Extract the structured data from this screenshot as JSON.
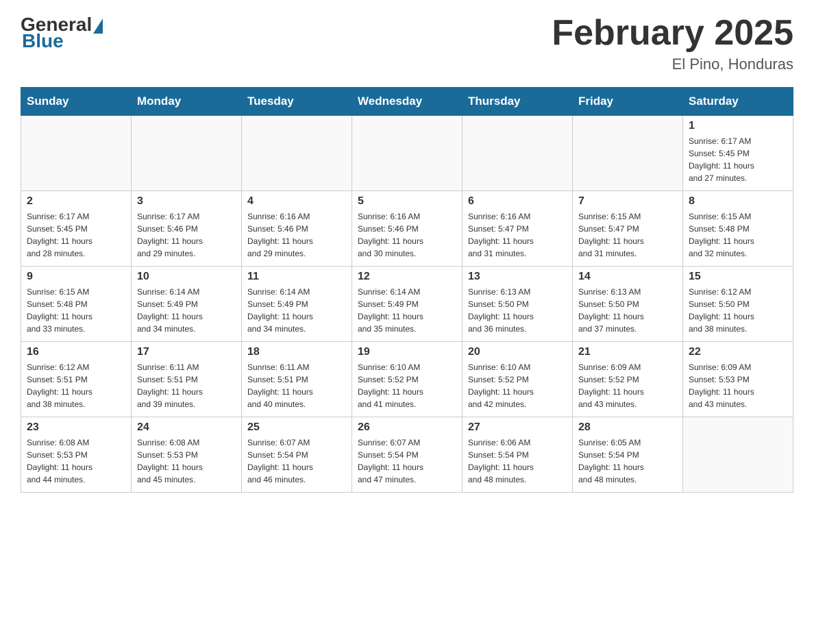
{
  "logo": {
    "general": "General",
    "blue": "Blue"
  },
  "header": {
    "title": "February 2025",
    "subtitle": "El Pino, Honduras"
  },
  "weekdays": [
    "Sunday",
    "Monday",
    "Tuesday",
    "Wednesday",
    "Thursday",
    "Friday",
    "Saturday"
  ],
  "weeks": [
    [
      {
        "day": "",
        "info": ""
      },
      {
        "day": "",
        "info": ""
      },
      {
        "day": "",
        "info": ""
      },
      {
        "day": "",
        "info": ""
      },
      {
        "day": "",
        "info": ""
      },
      {
        "day": "",
        "info": ""
      },
      {
        "day": "1",
        "info": "Sunrise: 6:17 AM\nSunset: 5:45 PM\nDaylight: 11 hours\nand 27 minutes."
      }
    ],
    [
      {
        "day": "2",
        "info": "Sunrise: 6:17 AM\nSunset: 5:45 PM\nDaylight: 11 hours\nand 28 minutes."
      },
      {
        "day": "3",
        "info": "Sunrise: 6:17 AM\nSunset: 5:46 PM\nDaylight: 11 hours\nand 29 minutes."
      },
      {
        "day": "4",
        "info": "Sunrise: 6:16 AM\nSunset: 5:46 PM\nDaylight: 11 hours\nand 29 minutes."
      },
      {
        "day": "5",
        "info": "Sunrise: 6:16 AM\nSunset: 5:46 PM\nDaylight: 11 hours\nand 30 minutes."
      },
      {
        "day": "6",
        "info": "Sunrise: 6:16 AM\nSunset: 5:47 PM\nDaylight: 11 hours\nand 31 minutes."
      },
      {
        "day": "7",
        "info": "Sunrise: 6:15 AM\nSunset: 5:47 PM\nDaylight: 11 hours\nand 31 minutes."
      },
      {
        "day": "8",
        "info": "Sunrise: 6:15 AM\nSunset: 5:48 PM\nDaylight: 11 hours\nand 32 minutes."
      }
    ],
    [
      {
        "day": "9",
        "info": "Sunrise: 6:15 AM\nSunset: 5:48 PM\nDaylight: 11 hours\nand 33 minutes."
      },
      {
        "day": "10",
        "info": "Sunrise: 6:14 AM\nSunset: 5:49 PM\nDaylight: 11 hours\nand 34 minutes."
      },
      {
        "day": "11",
        "info": "Sunrise: 6:14 AM\nSunset: 5:49 PM\nDaylight: 11 hours\nand 34 minutes."
      },
      {
        "day": "12",
        "info": "Sunrise: 6:14 AM\nSunset: 5:49 PM\nDaylight: 11 hours\nand 35 minutes."
      },
      {
        "day": "13",
        "info": "Sunrise: 6:13 AM\nSunset: 5:50 PM\nDaylight: 11 hours\nand 36 minutes."
      },
      {
        "day": "14",
        "info": "Sunrise: 6:13 AM\nSunset: 5:50 PM\nDaylight: 11 hours\nand 37 minutes."
      },
      {
        "day": "15",
        "info": "Sunrise: 6:12 AM\nSunset: 5:50 PM\nDaylight: 11 hours\nand 38 minutes."
      }
    ],
    [
      {
        "day": "16",
        "info": "Sunrise: 6:12 AM\nSunset: 5:51 PM\nDaylight: 11 hours\nand 38 minutes."
      },
      {
        "day": "17",
        "info": "Sunrise: 6:11 AM\nSunset: 5:51 PM\nDaylight: 11 hours\nand 39 minutes."
      },
      {
        "day": "18",
        "info": "Sunrise: 6:11 AM\nSunset: 5:51 PM\nDaylight: 11 hours\nand 40 minutes."
      },
      {
        "day": "19",
        "info": "Sunrise: 6:10 AM\nSunset: 5:52 PM\nDaylight: 11 hours\nand 41 minutes."
      },
      {
        "day": "20",
        "info": "Sunrise: 6:10 AM\nSunset: 5:52 PM\nDaylight: 11 hours\nand 42 minutes."
      },
      {
        "day": "21",
        "info": "Sunrise: 6:09 AM\nSunset: 5:52 PM\nDaylight: 11 hours\nand 43 minutes."
      },
      {
        "day": "22",
        "info": "Sunrise: 6:09 AM\nSunset: 5:53 PM\nDaylight: 11 hours\nand 43 minutes."
      }
    ],
    [
      {
        "day": "23",
        "info": "Sunrise: 6:08 AM\nSunset: 5:53 PM\nDaylight: 11 hours\nand 44 minutes."
      },
      {
        "day": "24",
        "info": "Sunrise: 6:08 AM\nSunset: 5:53 PM\nDaylight: 11 hours\nand 45 minutes."
      },
      {
        "day": "25",
        "info": "Sunrise: 6:07 AM\nSunset: 5:54 PM\nDaylight: 11 hours\nand 46 minutes."
      },
      {
        "day": "26",
        "info": "Sunrise: 6:07 AM\nSunset: 5:54 PM\nDaylight: 11 hours\nand 47 minutes."
      },
      {
        "day": "27",
        "info": "Sunrise: 6:06 AM\nSunset: 5:54 PM\nDaylight: 11 hours\nand 48 minutes."
      },
      {
        "day": "28",
        "info": "Sunrise: 6:05 AM\nSunset: 5:54 PM\nDaylight: 11 hours\nand 48 minutes."
      },
      {
        "day": "",
        "info": ""
      }
    ]
  ]
}
